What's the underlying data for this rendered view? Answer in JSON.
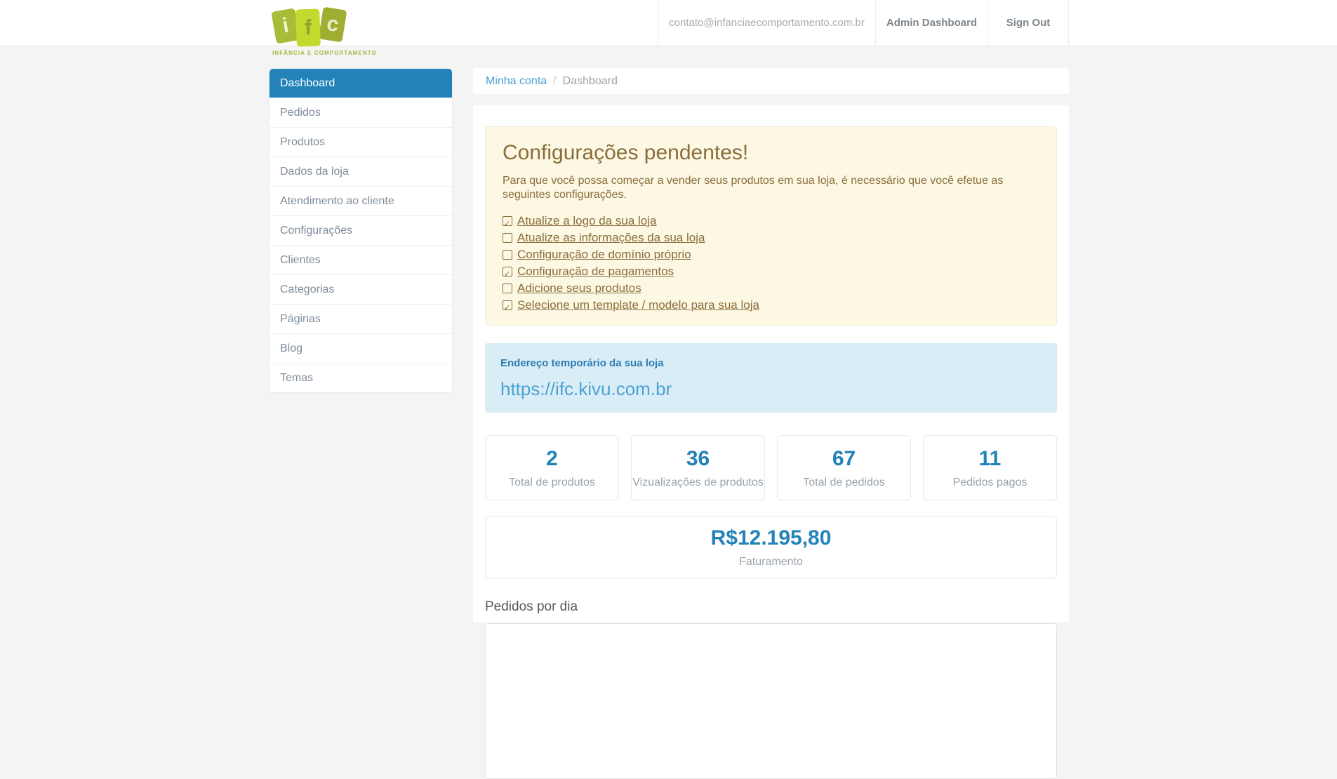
{
  "header": {
    "logo": {
      "letters": [
        "i",
        "f",
        "c"
      ],
      "tagline": "INFÂNCIA E COMPORTAMENTO"
    },
    "nav": {
      "email": "contato@infanciaecomportamento.com.br",
      "admin_label": "Admin Dashboard",
      "signout_label": "Sign Out"
    }
  },
  "sidebar": {
    "items": [
      {
        "label": "Dashboard",
        "active": true
      },
      {
        "label": "Pedidos",
        "active": false
      },
      {
        "label": "Produtos",
        "active": false
      },
      {
        "label": "Dados da loja",
        "active": false
      },
      {
        "label": "Atendimento ao cliente",
        "active": false
      },
      {
        "label": "Configurações",
        "active": false
      },
      {
        "label": "Clientes",
        "active": false
      },
      {
        "label": "Categorias",
        "active": false
      },
      {
        "label": "Páginas",
        "active": false
      },
      {
        "label": "Blog",
        "active": false
      },
      {
        "label": "Temas",
        "active": false
      }
    ]
  },
  "breadcrumb": {
    "link": "Minha conta",
    "separator": "/",
    "current": "Dashboard"
  },
  "pending": {
    "title": "Configurações pendentes!",
    "subtitle": "Para que você possa começar a vender seus produtos em sua loja, é necessário que você efetue as seguintes configurações.",
    "items": [
      {
        "label": "Atualize a logo da sua loja",
        "checked": true
      },
      {
        "label": "Atualize as informações da sua loja",
        "checked": false
      },
      {
        "label": "Configuração de domínio próprio",
        "checked": false
      },
      {
        "label": "Configuração de pagamentos",
        "checked": true
      },
      {
        "label": "Adicione seus produtos",
        "checked": false
      },
      {
        "label": "Selecione um template / modelo para sua loja",
        "checked": true
      }
    ]
  },
  "temp_address": {
    "label": "Endereço temporário da sua loja",
    "url": "https://ifc.kivu.com.br"
  },
  "stats": [
    {
      "value": "2",
      "label": "Total de produtos"
    },
    {
      "value": "36",
      "label": "Vizualizações de produtos"
    },
    {
      "value": "67",
      "label": "Total de pedidos"
    },
    {
      "value": "11",
      "label": "Pedidos pagos"
    }
  ],
  "revenue": {
    "value": "R$12.195,80",
    "label": "Faturamento"
  },
  "orders_section": {
    "title": "Pedidos por dia"
  },
  "colors": {
    "accent_blue": "#2383b9",
    "link_blue": "#4a9fd4",
    "warning_bg": "#fcf8e3",
    "warning_text": "#8a6d3b",
    "info_bg": "#d9edf7",
    "info_url": "#4ba2d3",
    "page_bg": "#f4f4f5",
    "logo_green_light": "#c3d92e",
    "logo_green_olive": "#a9bc38"
  }
}
